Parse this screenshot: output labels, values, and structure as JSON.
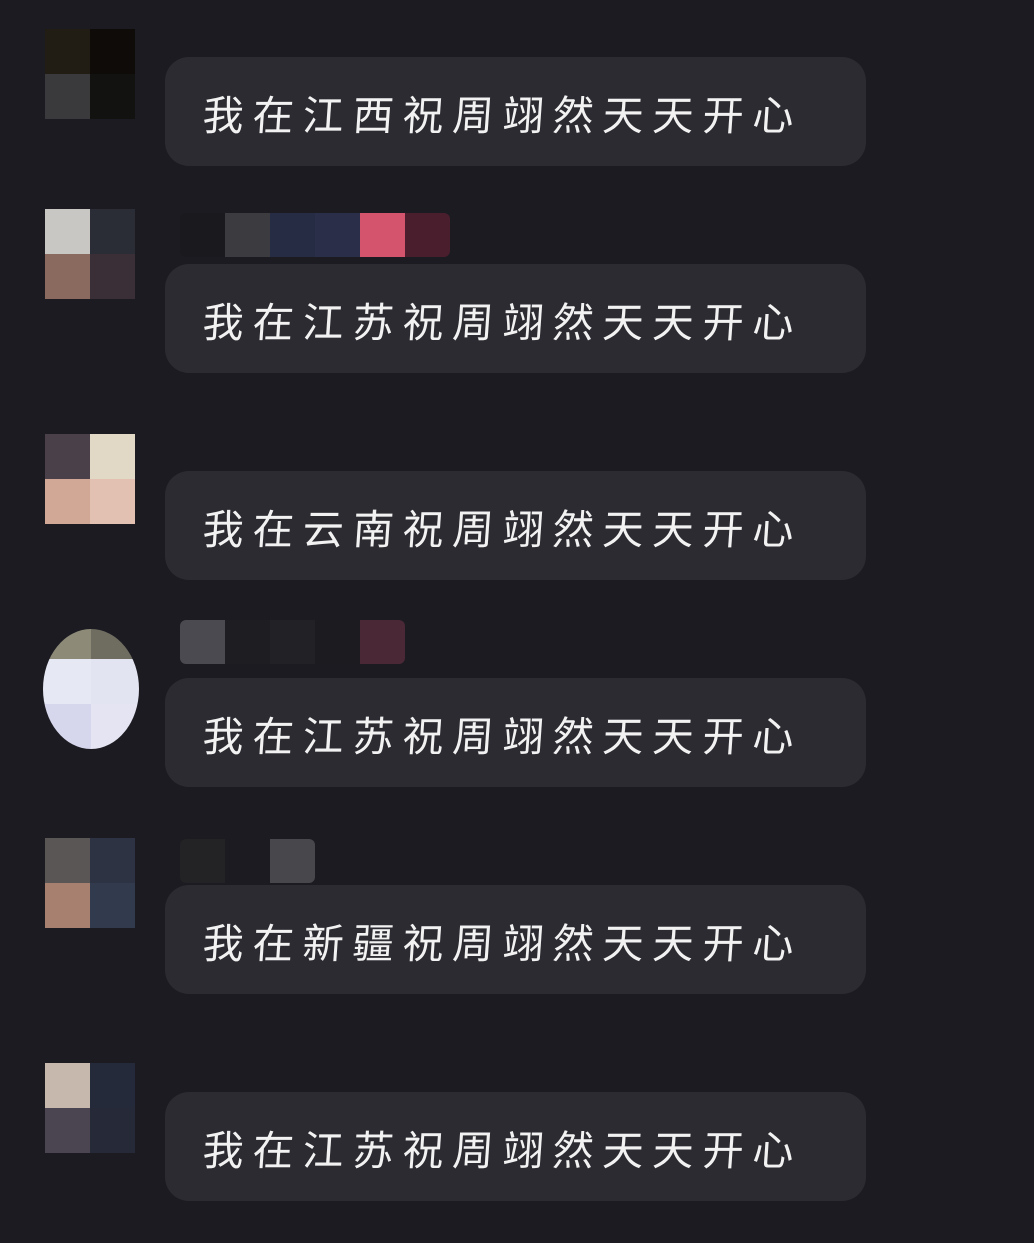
{
  "chat": {
    "messages": [
      {
        "text": "我在江西祝周翊然天天开心",
        "avatar_icon": "pixelated-avatar-icon",
        "avatar_colors": [
          "#221d14",
          "#0e0b08",
          "#3a3a3c",
          "#121210"
        ],
        "nickname_colors": []
      },
      {
        "text": "我在江苏祝周翊然天天开心",
        "avatar_icon": "pixelated-avatar-icon",
        "avatar_colors": [
          "#c9c7c4",
          "#2a2c36",
          "#8a6a5e",
          "#3a2f36"
        ],
        "nickname_colors": [
          "#1a1a1e",
          "#3b3b40",
          "#262c44",
          "#2a2e48",
          "#d4546e",
          "#4a1e2c"
        ]
      },
      {
        "text": "我在云南祝周翊然天天开心",
        "avatar_icon": "pixelated-avatar-icon",
        "avatar_colors": [
          "#4a4049",
          "#e2d8c6",
          "#d1a796",
          "#e2c0b2"
        ],
        "nickname_colors": []
      },
      {
        "text": "我在江苏祝周翊然天天开心",
        "avatar_icon": "pixelated-avatar-icon",
        "avatar_colors": [
          "#8d8a78",
          "#6f6c60",
          "#e6e8f4",
          "#e2e4f2"
        ],
        "nickname_colors": [
          "#4a4a50",
          "#1e1e22",
          "#222226",
          "#1c1c20",
          "#4a2836"
        ]
      },
      {
        "text": "我在新疆祝周翊然天天开心",
        "avatar_icon": "pixelated-avatar-icon",
        "avatar_colors": [
          "#5a5656",
          "#2e3344",
          "#a88070",
          "#323a4e"
        ],
        "nickname_colors": [
          "#232326",
          "#1b1b21",
          "#47474c"
        ]
      },
      {
        "text": "我在江苏祝周翊然天天开心",
        "avatar_icon": "pixelated-avatar-icon",
        "avatar_colors": [
          "#c7b8ae",
          "#252a3a",
          "#4a4550",
          "#262a38"
        ],
        "nickname_colors": []
      }
    ]
  }
}
